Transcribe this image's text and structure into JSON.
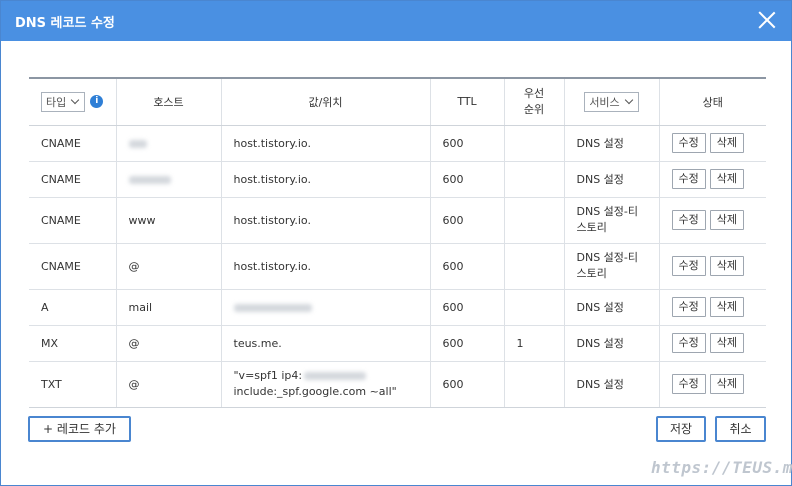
{
  "dialog": {
    "title": "DNS 레코드 수정",
    "close_label": "×"
  },
  "table": {
    "headers": {
      "type_select": "타입",
      "info_icon": "i",
      "host": "호스트",
      "value": "값/위치",
      "ttl": "TTL",
      "priority": "우선\n순위",
      "service_select": "서비스",
      "status": "상태"
    },
    "edit_label": "수정",
    "delete_label": "삭제",
    "rows": [
      {
        "type": "CNAME",
        "host": "",
        "host_redacted": true,
        "value": "host.tistory.io.",
        "ttl": "600",
        "priority": "",
        "service": "DNS 설정"
      },
      {
        "type": "CNAME",
        "host": "",
        "host_redacted": true,
        "value": "host.tistory.io.",
        "ttl": "600",
        "priority": "",
        "service": "DNS 설정"
      },
      {
        "type": "CNAME",
        "host": "www",
        "value": "host.tistory.io.",
        "ttl": "600",
        "priority": "",
        "service": "DNS 설정-티\n스토리"
      },
      {
        "type": "CNAME",
        "host": "@",
        "value": "host.tistory.io.",
        "ttl": "600",
        "priority": "",
        "service": "DNS 설정-티\n스토리"
      },
      {
        "type": "A",
        "host": "mail",
        "value": "",
        "value_redacted": true,
        "ttl": "600",
        "priority": "",
        "service": "DNS 설정"
      },
      {
        "type": "MX",
        "host": "@",
        "value": "teus.me.",
        "ttl": "600",
        "priority": "1",
        "service": "DNS 설정"
      },
      {
        "type": "TXT",
        "host": "@",
        "value_line1": "\"v=spf1 ip4:",
        "value_line2": "include:_spf.google.com ~all\"",
        "ttl": "600",
        "priority": "",
        "service": "DNS 설정"
      }
    ]
  },
  "footer": {
    "add_record": "+ 레코드 추가",
    "save": "저장",
    "cancel": "취소"
  },
  "watermark": "https://TEUS.me",
  "colors": {
    "titlebar": "#4a90e2",
    "accent": "#4a86d0",
    "info": "#2f7fd6"
  }
}
